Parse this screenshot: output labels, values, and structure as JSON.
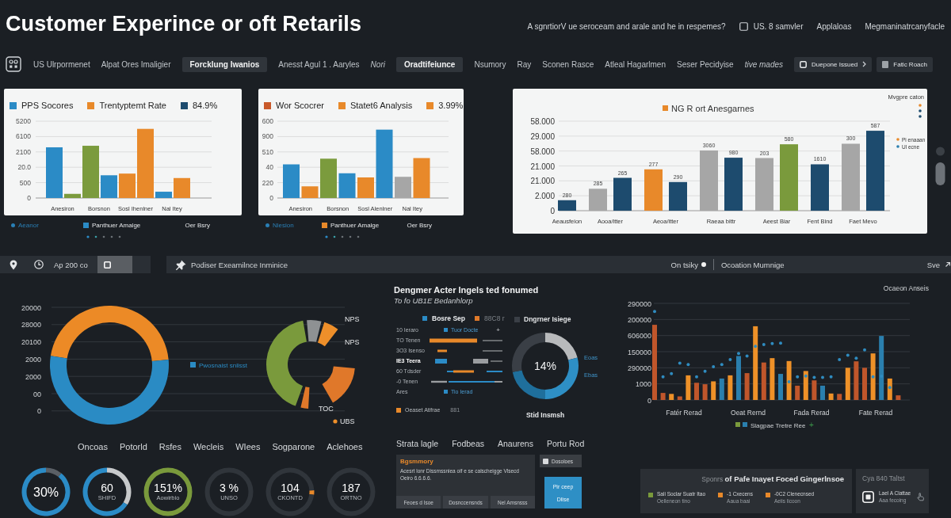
{
  "header": {
    "title": "Customer Experince or oft Retarils",
    "question": "A sgnrtiorV ue seroceam and arale and he in respemes?",
    "checkbox": {
      "label": "US. 8 samvler",
      "checked": false
    },
    "links": [
      "Applaloas",
      "Megmaninatrcanyfacle"
    ]
  },
  "nav": {
    "items": [
      {
        "label": "US Ulrpormenet",
        "selected": false,
        "italic": false
      },
      {
        "label": "Alpat Ores Imaligier",
        "selected": false,
        "italic": false
      },
      {
        "label": "Forcklung Iwanios",
        "selected": true,
        "italic": false
      },
      {
        "label": "Anesst Agul 1 . Aaryles",
        "selected": false,
        "italic": false
      },
      {
        "label": "Nori",
        "selected": false,
        "italic": true
      },
      {
        "label": "Oradtifeiunce",
        "selected": true,
        "italic": false
      },
      {
        "label": "Nsumory",
        "selected": false,
        "italic": false
      },
      {
        "label": "Ray",
        "selected": false,
        "italic": false
      },
      {
        "label": "Sconen Rasce",
        "selected": false,
        "italic": false
      },
      {
        "label": "Atleal Hagarlmen",
        "selected": false,
        "italic": false
      },
      {
        "label": "Seser Pecidyise",
        "selected": false,
        "italic": false
      },
      {
        "label": "tive mades",
        "selected": false,
        "italic": true
      }
    ],
    "buttons": [
      {
        "label": "Duepone Issued",
        "kind": "menu"
      },
      {
        "label": "Fatlc Roach",
        "kind": "plain"
      }
    ]
  },
  "cards": [
    {
      "kind": "compact",
      "legend": [
        {
          "label": "PPS Socores",
          "color": "#2b8bc6"
        },
        {
          "label": "Trentyptemt Rate",
          "color": "#e8892a"
        },
        {
          "label": "84.9%",
          "color": "#1d4b6e"
        }
      ],
      "axis_labels": [
        "5200",
        "6100",
        "2100",
        "20.0",
        "500",
        "0"
      ],
      "categories": [
        "Anesiron",
        "Borsnon",
        "Sosl Ihenlner",
        "Nal Itey"
      ],
      "footer": [
        {
          "kind": "dot",
          "label": "Aeanor",
          "color": "#2a7fb5"
        },
        {
          "kind": "square",
          "label": "Panthuer Amalge",
          "color": "#2b8bc6"
        },
        {
          "kind": "text",
          "label": "Oer Bsry"
        }
      ]
    },
    {
      "kind": "compact",
      "legend": [
        {
          "label": "Wor Scocrer",
          "color": "#c9592a"
        },
        {
          "label": "Statet6 Analysis",
          "color": "#e8892a"
        },
        {
          "label": "3.99%",
          "color": "#e8892a"
        }
      ],
      "axis_labels": [
        "600",
        "900",
        "510",
        "40",
        "220",
        "0"
      ],
      "categories": [
        "Anesiron",
        "Borsnon",
        "Sosl Alenlner",
        "Nal Itey"
      ],
      "footer": [
        {
          "kind": "dot",
          "label": "Nlesion",
          "color": "#2a7fb5"
        },
        {
          "kind": "square",
          "label": "Panthuer Amalge",
          "color": "#e8892a"
        },
        {
          "kind": "text",
          "label": "Oer Bsry"
        }
      ]
    },
    {
      "kind": "wide",
      "title": "NG R ort Anesgarnes",
      "note": "Mvgpre caton",
      "legend": [
        {
          "label": "Pi enaaan",
          "color": "#e8892a"
        },
        {
          "label": "Ul ecne",
          "color": "#2a7fae"
        }
      ],
      "axis_labels": [
        "58.000",
        "29.000",
        "58.000",
        "21.000",
        "21.000",
        "2.000",
        "0"
      ],
      "value_labels": [
        "280",
        "285",
        "265",
        "277",
        "290",
        "3060",
        "980",
        "203",
        "580",
        "1610",
        "300",
        "587"
      ],
      "categories": [
        "Aeausfeion",
        "Aooa/itter",
        "Aeoa/itter",
        "Raeaa bittr",
        "Aeest Biar",
        "Fent Bind",
        "Faet Mevo"
      ]
    }
  ],
  "toolbar": {
    "left_label": "Ap 200 co",
    "title": "Podiser Exeamilnce Inminice",
    "status": "On tsiky",
    "section": "Ocoation Mumnige",
    "action": "Sve"
  },
  "overview": {
    "axis_labels": [
      "20000",
      "28000",
      "20100",
      "2000",
      "2000",
      "00",
      "0"
    ],
    "ring_chart": {
      "chart_data": {
        "type": "donut",
        "values": [
          46,
          54
        ],
        "colors": [
          "#ec8a26",
          "#2a8bc4"
        ]
      }
    },
    "legend": {
      "label": "Pwosnaist snlisst",
      "color": "#2a8bc4"
    },
    "ring_labels": [
      {
        "label": "NPS",
        "kind": "plain"
      },
      {
        "label": "NPS",
        "kind": "plain"
      },
      {
        "label": "TOC",
        "kind": "plain"
      },
      {
        "label": "UBS",
        "kind": "dot"
      }
    ]
  },
  "kpis": {
    "labels": [
      "Oncoas",
      "Potorld",
      "Rsfes",
      "Wecleis",
      "WIees",
      "Sogparone",
      "Aclehoes"
    ],
    "rings": [
      {
        "kind": "split",
        "value": "30%",
        "chart_data": {
          "type": "donut",
          "values": [
            11,
            89
          ],
          "colors": [
            "#5b6066",
            "#2b8bc6"
          ]
        }
      },
      {
        "kind": "split",
        "value": "60",
        "caption": "SHIFD",
        "chart_data": {
          "type": "donut",
          "values": [
            34,
            66
          ],
          "colors": [
            "#c7c9cb",
            "#2b8bc6"
          ]
        }
      },
      {
        "kind": "plain",
        "value": "151%",
        "caption": "Aowirbio",
        "color": "#7a9a3c"
      },
      {
        "kind": "plain",
        "value": "3 %",
        "caption": "UNSO",
        "color": "#30353b"
      },
      {
        "kind": "split",
        "value": "104",
        "caption": "CKONTD",
        "chart_data": {
          "type": "donut",
          "values": [
            24,
            3,
            73
          ],
          "colors": [
            "#30353b",
            "#e8892a",
            "#30353b"
          ]
        }
      },
      {
        "kind": "plain",
        "value": "187",
        "caption": "ORTNO",
        "color": "#30353b"
      }
    ]
  },
  "impact": {
    "title": "Dengmer Acter Ingels ted fonumed",
    "subtitle": "To fo UB1E Bedanhlorp",
    "legend": [
      {
        "label": "Bosre Sep",
        "color": "#2b8bc6",
        "dimmed": false
      },
      {
        "label": "88C8 r",
        "color": "#e07a2a",
        "dimmed": true
      }
    ],
    "rows": [
      {
        "label": "10 Ieraro",
        "kind": "note",
        "note": "Tuor Docte",
        "extra": "+",
        "highlighted": false
      },
      {
        "label": "TO Tenen",
        "kind": "bars",
        "highlighted": false
      },
      {
        "label": "3O3 Isenso",
        "kind": "bars",
        "highlighted": false
      },
      {
        "label": "IE3 Teera",
        "kind": "bars",
        "highlighted": true
      },
      {
        "label": "60 Tdsder",
        "kind": "bars",
        "highlighted": false
      },
      {
        "label": "-0 Tenen",
        "kind": "bars",
        "highlighted": false
      },
      {
        "label": "Ares",
        "kind": "note",
        "note": "Tio Ierad",
        "highlighted": false
      }
    ],
    "footnote": {
      "label": "Oeaset Atifrae",
      "value": "881",
      "color": "#e8892a"
    },
    "donut": {
      "title": "Dngrner Isiege",
      "chart_data": {
        "type": "donut",
        "values": [
          21,
          29,
          22,
          28
        ],
        "colors": [
          "#b8babc",
          "#2e8fc5",
          "#1f6f9c",
          "#3a3f46"
        ]
      },
      "center": "14%",
      "labels": [
        "Eoas",
        "Ebas"
      ],
      "caption": "Stid Insmsh"
    }
  },
  "summary": {
    "labels": [
      "Strata lagle",
      "Fodbeas",
      "Anaurens",
      "Portu Rod"
    ],
    "panel": {
      "title": "Bgsmmory",
      "text": "Acesrt lonr Dissmssniea oif e se calscheigge Vlsecd Oeiro 6.6.6.6.",
      "buttons": [
        "Feoes d Isoe",
        "Dosnccensnds",
        "Nel Amsnsss"
      ]
    },
    "side_buttons": [
      {
        "kind": "secondary",
        "lines": [
          "Dosoloes"
        ]
      },
      {
        "kind": "primary",
        "lines": [
          "Pir ceep",
          "Dlise"
        ]
      }
    ]
  },
  "analysis": {
    "title": "Ocaeon Anseis",
    "axis_labels": [
      "290000",
      "200000",
      "606000",
      "150000",
      "290000",
      "1000",
      "0"
    ],
    "categories": [
      "Fatér Rerad",
      "Oeat Rernd",
      "Fada Rerad",
      "Fate Rerad"
    ],
    "legend": {
      "label": "Slagpae Tretre Ree",
      "swatches": [
        {
          "color": "#7a9a3c"
        },
        {
          "color": "#2a7fae"
        }
      ],
      "extra": "+"
    }
  },
  "highlights": {
    "heading": "Sponrs **of Pafe Inayet Foced Gingerlnsoe**",
    "items": [
      {
        "color": "#7a9a3c",
        "title": "Sali Soclar Suatr Itao",
        "subtitle": "Oelleneon tino"
      },
      {
        "color": "#e8892a",
        "title": "-1 Cxecens",
        "subtitle": "Aaua baai"
      },
      {
        "color": "#e8892a",
        "title": "-0C2 Clenecnsed",
        "subtitle": "Aeiis licoon"
      }
    ]
  },
  "contact": {
    "title": "Cya 840 Taltst",
    "line": "Lael A Clattae",
    "subline": "Aaa fecoing"
  }
}
